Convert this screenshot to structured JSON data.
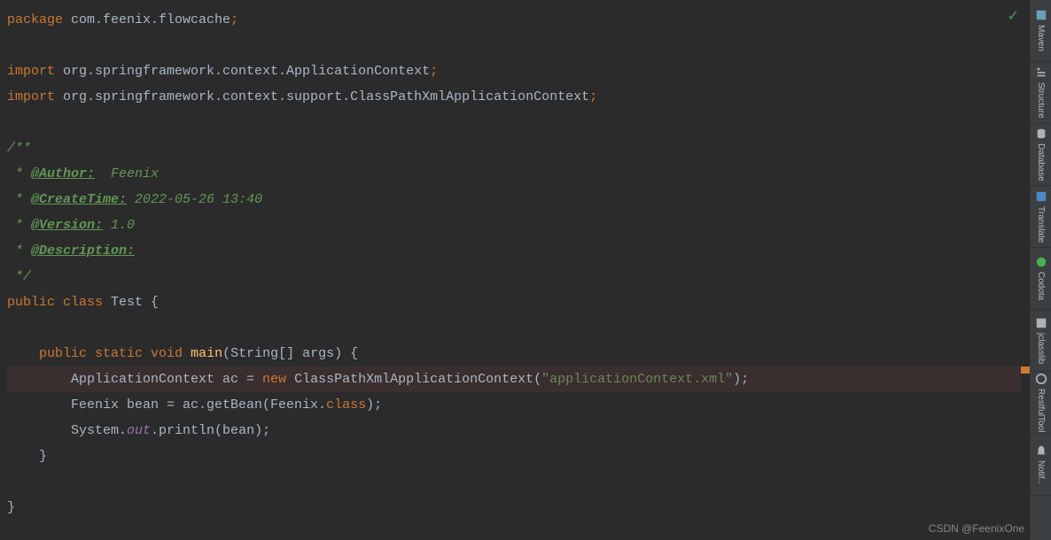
{
  "code": {
    "l1_package_kw": "package ",
    "l1_package_name": "com.feenix.flowcache",
    "l1_semi": ";",
    "l3_import_kw": "import ",
    "l3_import_path": "org.springframework.context.ApplicationContext",
    "l3_semi": ";",
    "l4_import_kw": "import ",
    "l4_import_path": "org.springframework.context.support.ClassPathXmlApplicationContext",
    "l4_semi": ";",
    "l6_comment_start": "/**",
    "l7_star": " * ",
    "l7_tag": "@Author:",
    "l7_val": "  Feenix",
    "l8_star": " * ",
    "l8_tag": "@CreateTime:",
    "l8_val": " 2022-05-26 13:40",
    "l9_star": " * ",
    "l9_tag": "@Version:",
    "l9_val": " 1.0",
    "l10_star": " * ",
    "l10_tag": "@Description:",
    "l11_comment_end": " */",
    "l12_public": "public ",
    "l12_class": "class ",
    "l12_name": "Test ",
    "l12_brace": "{",
    "l14_public": "    public ",
    "l14_static": "static ",
    "l14_void": "void ",
    "l14_main": "main",
    "l14_params": "(String[] args) {",
    "l15_type": "        ApplicationContext ac = ",
    "l15_new": "new ",
    "l15_class": "ClassPathXmlApplicationContext(",
    "l15_string": "\"applicationContext.xml\"",
    "l15_end": ");",
    "l16_text": "        Feenix bean = ac.getBean(Feenix.",
    "l16_class": "class",
    "l16_end": ");",
    "l17_system": "        System.",
    "l17_out": "out",
    "l17_println": ".println(bean);",
    "l18_brace": "    }",
    "l20_brace": "}"
  },
  "sidebar": {
    "items": [
      {
        "label": "Maven"
      },
      {
        "label": "Structure"
      },
      {
        "label": "Database"
      },
      {
        "label": "Translate"
      },
      {
        "label": "Codota"
      },
      {
        "label": "jclasslib"
      },
      {
        "label": "RestfulTool"
      },
      {
        "label": "Notif.."
      }
    ]
  },
  "watermark": "CSDN @FeenixOne"
}
